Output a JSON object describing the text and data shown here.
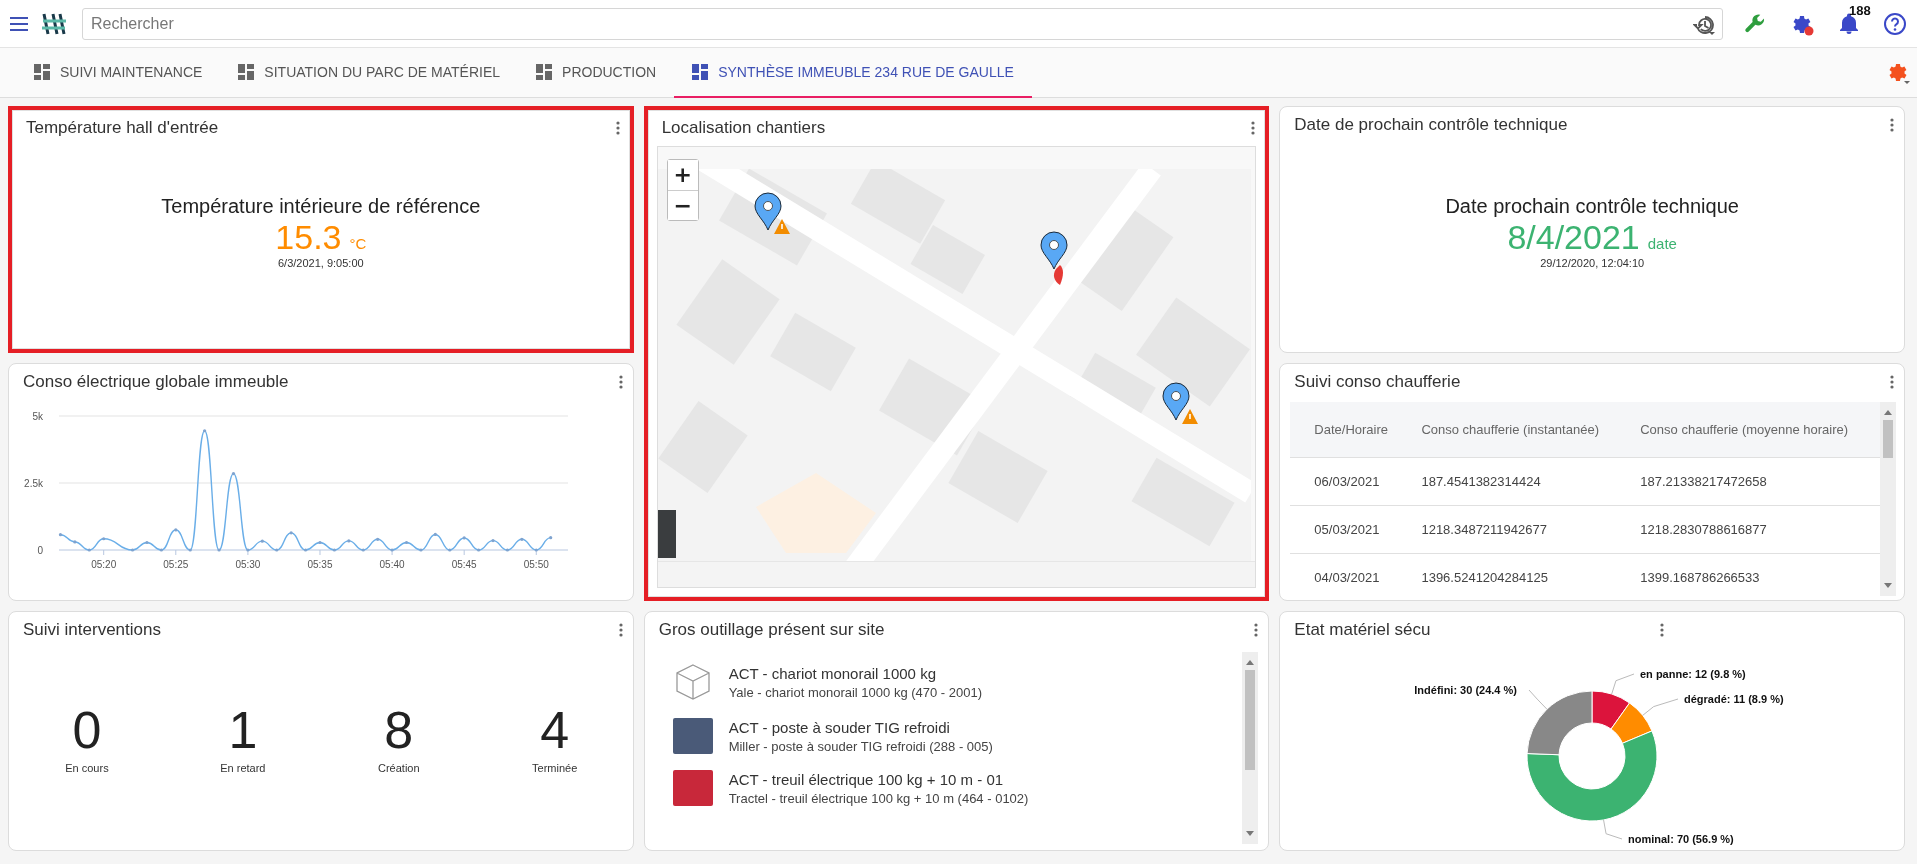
{
  "topbar": {
    "search": {
      "placeholder": "Rechercher"
    },
    "notifications": {
      "count": "188"
    }
  },
  "tabs": [
    {
      "label": "SUIVI MAINTENANCE",
      "selected": false
    },
    {
      "label": "SITUATION DU PARC DE MATÉRIEL",
      "selected": false
    },
    {
      "label": "PRODUCTION",
      "selected": false
    },
    {
      "label": "SYNTHÈSE IMMEUBLE 234 RUE DE GAULLE",
      "selected": true
    }
  ],
  "cards": [
    {
      "kind": "kpi",
      "title": "Température hall d'entrée",
      "highlighted": true,
      "heading": "Température intérieure de référence",
      "value": "15.3",
      "unit": "°C",
      "color": "#ff8c00",
      "timestamp": "6/3/2021, 9:05:00"
    },
    {
      "kind": "map",
      "title": "Localisation chantiers",
      "highlighted": true,
      "zoom_controls": [
        "+",
        "−"
      ]
    },
    {
      "kind": "kpi",
      "title": "Date de prochain contrôle technique",
      "highlighted": false,
      "heading": "Date prochain contrôle technique",
      "value": "8/4/2021",
      "unit": "date",
      "color": "#3cb371",
      "timestamp": "29/12/2020, 12:04:10"
    },
    {
      "kind": "line",
      "title": "Conso électrique globale immeuble",
      "highlighted": false,
      "chart_data": {
        "type": "line",
        "categories": [
          null,
          null,
          null,
          "05:20",
          null,
          null,
          null,
          null,
          "05:25",
          null,
          null,
          null,
          null,
          "05:30",
          null,
          null,
          null,
          null,
          "05:35",
          null,
          null,
          null,
          null,
          "05:40",
          null,
          null,
          null,
          null,
          "05:45",
          null,
          null,
          null,
          null,
          "05:50",
          null
        ],
        "series": [
          {
            "color": "#6aaee8",
            "marker": true,
            "values": [
              570,
              300,
              0,
              420,
              null,
              0,
              280,
              0,
              750,
              0,
              4450,
              0,
              2850,
              0,
              330,
              0,
              640,
              0,
              280,
              0,
              340,
              0,
              400,
              0,
              280,
              0,
              580,
              0,
              450,
              0,
              350,
              0,
              400,
              0,
              460
            ]
          }
        ],
        "ylim": [
          0,
          5000
        ],
        "yticks": [
          {
            "value": 0,
            "label": "0"
          },
          {
            "value": 2500,
            "label": "2.5k"
          },
          {
            "value": 5000,
            "label": "5k"
          }
        ]
      }
    },
    {
      "kind": "table",
      "title": "Suivi conso chaufferie",
      "highlighted": false,
      "columns": [
        "Date/Horaire",
        "Conso chaufferie (instantanée)",
        "Conso chaufferie (moyenne horaire)"
      ],
      "rows": [
        [
          "06/03/2021",
          "187.4541382314424",
          "187.21338217472658"
        ],
        [
          "05/03/2021",
          "1218.3487211942677",
          "1218.2830788616877"
        ],
        [
          "04/03/2021",
          "1396.5241204284125",
          "1399.168786266533"
        ]
      ]
    },
    {
      "kind": "counters",
      "title": "Suivi interventions",
      "highlighted": false,
      "counters": [
        {
          "value": "0",
          "label": "En cours"
        },
        {
          "value": "1",
          "label": "En retard"
        },
        {
          "value": "8",
          "label": "Création"
        },
        {
          "value": "4",
          "label": "Terminée"
        }
      ]
    },
    {
      "kind": "list",
      "title": "Gros outillage présent sur site",
      "highlighted": false,
      "items": [
        {
          "kind": "cube",
          "title": "ACT - chariot monorail 1000 kg",
          "subtitle": "Yale - chariot monorail 1000 kg (470 - 2001)"
        },
        {
          "kind": "photo",
          "title": "ACT - poste à souder TIG refroidi",
          "subtitle": "Miller - poste à souder TIG refroidi (288 - 005)"
        },
        {
          "kind": "photo",
          "title": "ACT - treuil électrique 100 kg + 10 m - 01",
          "subtitle": "Tractel - treuil électrique 100 kg + 10 m (464 - 0102)"
        }
      ]
    },
    {
      "kind": "donut",
      "title": "Etat matériel sécu",
      "highlighted": false,
      "chart_data": {
        "type": "donut",
        "series": [
          {
            "values": [
              9.8,
              8.9,
              56.9,
              24.4
            ]
          }
        ],
        "colors": [
          "#dc143c",
          "#ff8c00",
          "#3cb371",
          "#888888"
        ],
        "value_labels": [
          "en panne: 12 (9.8 %)",
          "dégradé: 11 (8.9 %)",
          "nominal: 70 (56.9 %)",
          "Indéfini: 30 (24.4 %)"
        ]
      }
    }
  ]
}
